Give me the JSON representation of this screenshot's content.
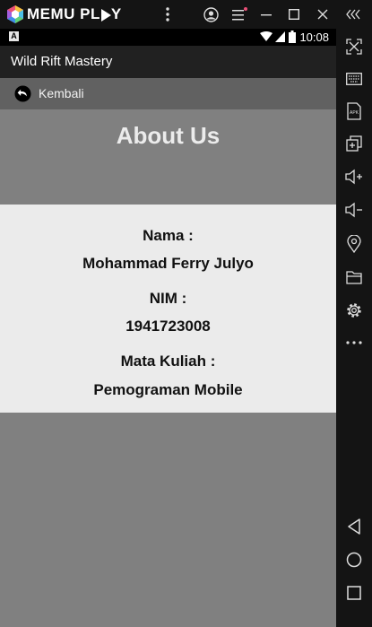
{
  "emulator": {
    "title_main": "MEMU PL",
    "title_end": "Y",
    "controls": [
      "account-icon",
      "menu-icon",
      "minimize-icon",
      "maximize-icon",
      "close-icon",
      "collapse-icon"
    ]
  },
  "status_bar": {
    "time": "10:08",
    "notification_icon": "A"
  },
  "app": {
    "title": "Wild Rift Mastery",
    "back_label": "Kembali",
    "heading": "About Us"
  },
  "profile": {
    "name_label": "Nama :",
    "name_value": "Mohammad Ferry Julyo",
    "nim_label": "NIM :",
    "nim_value": "1941723008",
    "course_label": "Mata Kuliah :",
    "course_value": "Pemograman Mobile"
  },
  "sidebar_icons": [
    "keymap-icon",
    "keyboard-icon",
    "apk-icon",
    "multi-instance-icon",
    "volume-up-icon",
    "volume-down-icon",
    "location-icon",
    "folder-icon",
    "settings-icon",
    "more-icon",
    "back-nav-icon",
    "home-nav-icon",
    "recents-nav-icon"
  ],
  "colors": {
    "screen_bg": "#808080",
    "card_bg": "#ebebeb",
    "appbar_bg": "#212121",
    "backbar_bg": "#616161"
  }
}
